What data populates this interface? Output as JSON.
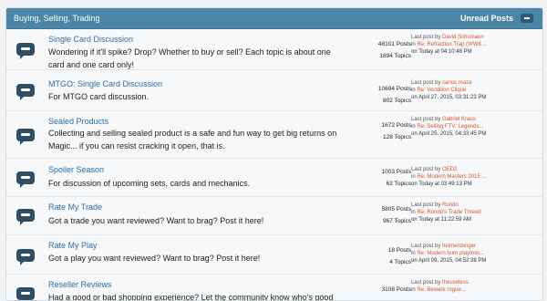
{
  "header": {
    "title": "Buying, Selling, Trading",
    "unread_label": "Unread Posts"
  },
  "forums": [
    {
      "name": "Single Card Discussion",
      "description": "Wondering if it'll spike? Drop? Whether to buy or sell? Each topic is about one card and one card only!",
      "posts": "48101 Posts",
      "topics": "1894 Topics",
      "last_by_label": "Last post by",
      "last_by": "David Schumann",
      "last_in_label": "in",
      "last_thread": "Re: Refraction Trap (WWK...",
      "last_time": "on Today at 04:10:48 PM"
    },
    {
      "name": "MTGO: Single Card Discussion",
      "description": "For MTGO card discussion.",
      "posts": "10694 Posts",
      "topics": "802 Topics",
      "last_by_label": "Last post by",
      "last_by": "carlos maza",
      "last_in_label": "in",
      "last_thread": "Re: Vendilion Clique",
      "last_time": "on April 27, 2015, 03:31:23 PM"
    },
    {
      "name": "Sealed Products",
      "description": "Collecting and selling sealed product is a safe and fun way to get big returns on Magic... if you can resist cracking it open, that is.",
      "posts": "1672 Posts",
      "topics": "128 Topics",
      "last_by_label": "Last post by",
      "last_by": "Gabriel Kraus",
      "last_in_label": "in",
      "last_thread": "Re: Selling FTV: Legends...",
      "last_time": "on April 25, 2015, 04:33:45 PM"
    },
    {
      "name": "Spoiler Season",
      "description": "For discussion of upcoming sets, cards and mechanics.",
      "posts": "1003 Posts",
      "topics": "62 Topics",
      "last_by_label": "Last post by",
      "last_by": "OED2",
      "last_in_label": "in",
      "last_thread": "Re: Modern Masters 2015 ...",
      "last_time": "on Today at 03:49:13 PM"
    },
    {
      "name": "Rate My Trade",
      "description": "Got a trade you want reviewed? Want to brag? Post it here!",
      "posts": "5805 Posts",
      "topics": "967 Topics",
      "last_by_label": "Last post by",
      "last_by": "Rondo",
      "last_in_label": "in",
      "last_thread": "Re: Rondo's Trade Thread",
      "last_time": "on Today at 11:22:59 AM"
    },
    {
      "name": "Rate My Play",
      "description": "Got a play you want reviewed? Want to brag? Post it here!",
      "posts": "18 Posts",
      "topics": "4 Topics",
      "last_by_label": "Last post by",
      "last_by": "heimerdonger",
      "last_in_label": "in",
      "last_thread": "Re: Modern burn play/mis...",
      "last_time": "on April 09, 2015, 04:52:38 PM"
    },
    {
      "name": "Reseller Reviews",
      "description": "Had a good or bad shopping experience? Let the community know who's good",
      "posts": "3108 Posts",
      "topics": "",
      "last_by_label": "Last post by",
      "last_by": "theuseless",
      "last_in_label": "in",
      "last_thread": "Re: Beware rogue...",
      "last_time": ""
    }
  ],
  "colors": {
    "header_bg": "#4b86a7",
    "forum_link": "#2b6fa6",
    "last_post_link": "#d9552c",
    "icon_bg": "#2e4e66"
  },
  "icons": {
    "forum": "speech-bubble-icon",
    "collapse": "minus-icon"
  }
}
